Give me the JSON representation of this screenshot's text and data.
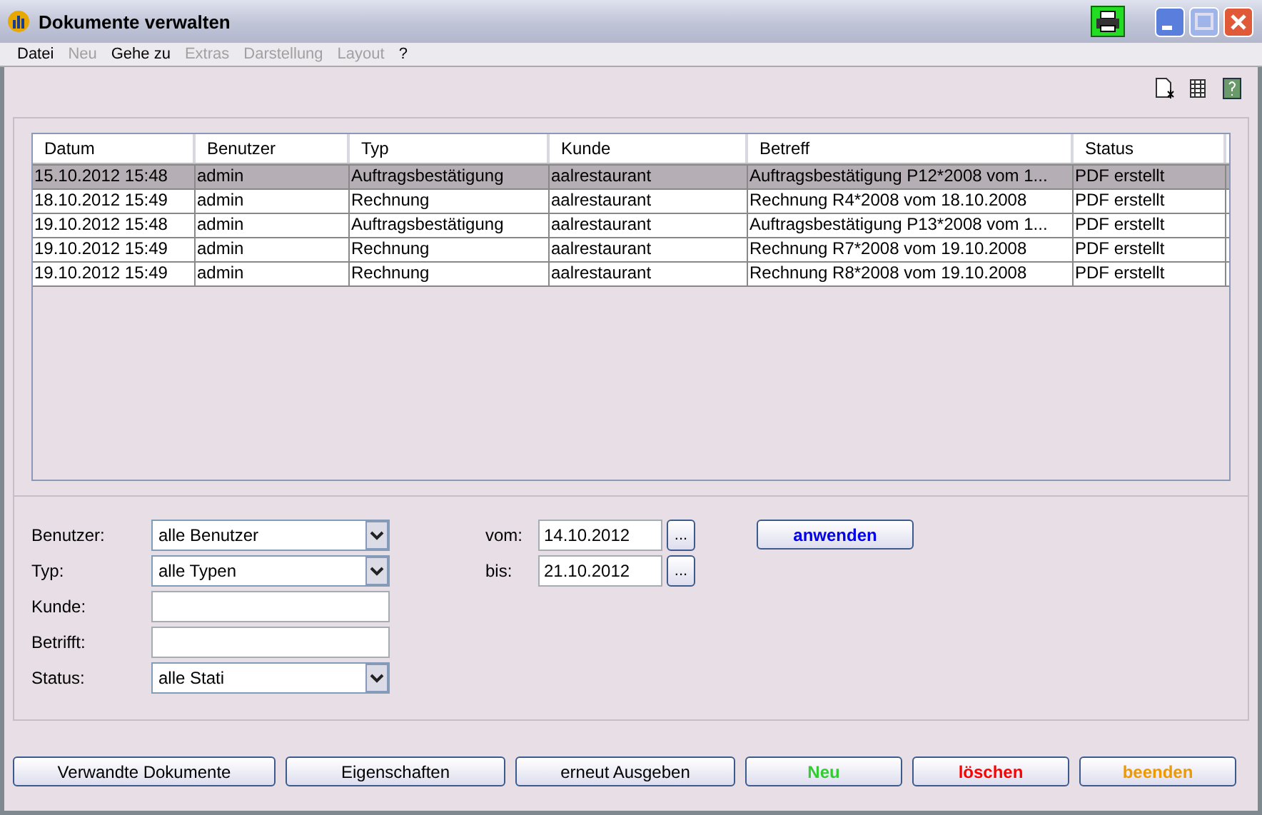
{
  "window": {
    "title": "Dokumente verwalten"
  },
  "menu": [
    {
      "label": "Datei",
      "disabled": false
    },
    {
      "label": "Neu",
      "disabled": true
    },
    {
      "label": "Gehe zu",
      "disabled": false
    },
    {
      "label": "Extras",
      "disabled": true
    },
    {
      "label": "Darstellung",
      "disabled": true
    },
    {
      "label": "Layout",
      "disabled": true
    },
    {
      "label": "?",
      "disabled": false
    }
  ],
  "table": {
    "columns": [
      "Datum",
      "Benutzer",
      "Typ",
      "Kunde",
      "Betreff",
      "Status"
    ],
    "rows": [
      {
        "selected": true,
        "cells": [
          "15.10.2012 15:48",
          "admin",
          "Auftragsbestätigung",
          "aalrestaurant",
          "Auftragsbestätigung P12*2008 vom 1...",
          "PDF erstellt"
        ]
      },
      {
        "selected": false,
        "cells": [
          "18.10.2012 15:49",
          "admin",
          "Rechnung",
          "aalrestaurant",
          "Rechnung R4*2008 vom 18.10.2008",
          "PDF erstellt"
        ]
      },
      {
        "selected": false,
        "cells": [
          "19.10.2012 15:48",
          "admin",
          "Auftragsbestätigung",
          "aalrestaurant",
          "Auftragsbestätigung P13*2008 vom 1...",
          "PDF erstellt"
        ]
      },
      {
        "selected": false,
        "cells": [
          "19.10.2012 15:49",
          "admin",
          "Rechnung",
          "aalrestaurant",
          "Rechnung R7*2008 vom 19.10.2008",
          "PDF erstellt"
        ]
      },
      {
        "selected": false,
        "cells": [
          "19.10.2012 15:49",
          "admin",
          "Rechnung",
          "aalrestaurant",
          "Rechnung R8*2008 vom 19.10.2008",
          "PDF erstellt"
        ]
      }
    ]
  },
  "filters": [
    {
      "label": "Benutzer:",
      "kind": "select",
      "value": "alle Benutzer"
    },
    {
      "label": "Typ:",
      "kind": "select",
      "value": "alle Typen"
    },
    {
      "label": "Kunde:",
      "kind": "text"
    },
    {
      "label": "Betrifft:",
      "kind": "text"
    },
    {
      "label": "Status:",
      "kind": "select",
      "value": "alle Stati"
    }
  ],
  "dates": [
    {
      "label": "vom:",
      "value": "14.10.2012",
      "button": "..."
    },
    {
      "label": "bis:",
      "value": "21.10.2012",
      "button": "..."
    }
  ],
  "apply_button": "anwenden",
  "buttons": [
    {
      "label": "Verwandte Dokumente",
      "color": "#000000"
    },
    {
      "label": "Eigenschaften",
      "color": "#000000"
    },
    {
      "label": "erneut Ausgeben",
      "color": "#000000"
    },
    {
      "label": "Neu",
      "color": "#33cc33"
    },
    {
      "label": "löschen",
      "color": "#ff0000"
    },
    {
      "label": "beenden",
      "color": "#ee9900"
    }
  ]
}
